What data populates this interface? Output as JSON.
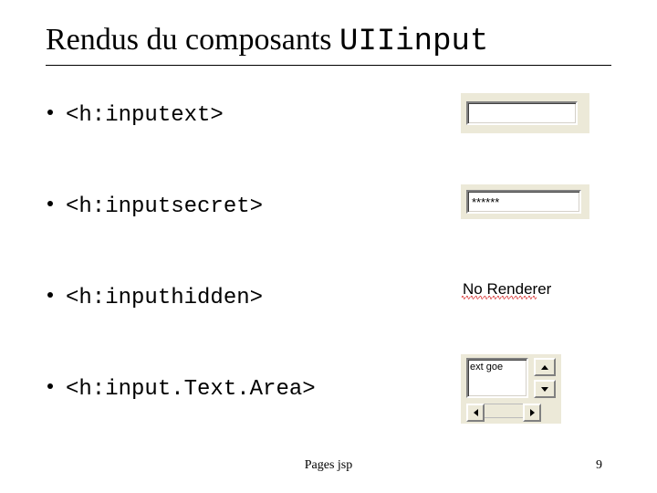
{
  "title": {
    "serif": "Rendus du composants ",
    "mono": "UIIinput"
  },
  "items": [
    {
      "label": "<h:inputext>",
      "kind": "text",
      "value": ""
    },
    {
      "label": "<h:inputsecret>",
      "kind": "secret",
      "value": "******"
    },
    {
      "label": "<h:inputhidden>",
      "kind": "hidden",
      "value": "No Renderer"
    },
    {
      "label": "<h:input.Text.Area>",
      "kind": "textarea",
      "value": "ext goe"
    }
  ],
  "footer": {
    "center": "Pages jsp",
    "page": "9"
  }
}
